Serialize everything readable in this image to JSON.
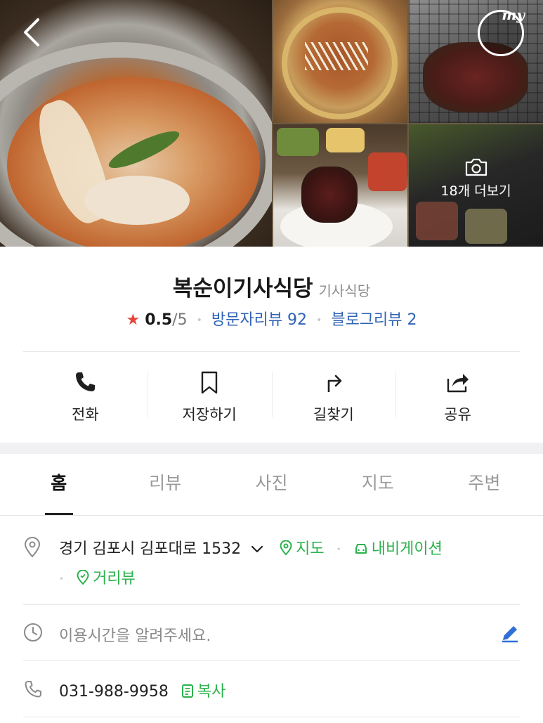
{
  "gallery": {
    "photos": [
      {
        "icon": "food-photo-stew"
      },
      {
        "icon": "food-photo-hotpot"
      },
      {
        "icon": "food-photo-grilled"
      },
      {
        "icon": "food-photo-sidedish"
      },
      {
        "icon": "food-photo-table"
      }
    ],
    "more_label": "18개 더보기",
    "badge_label": "my"
  },
  "place": {
    "name": "복순이기사식당",
    "category": "기사식당",
    "rating": "0.5",
    "rating_max": "/5",
    "visitor_review": "방문자리뷰 92",
    "blog_review": "블로그리뷰 2"
  },
  "actions": [
    {
      "label": "전화",
      "icon": "phone-icon"
    },
    {
      "label": "저장하기",
      "icon": "bookmark-icon"
    },
    {
      "label": "길찾기",
      "icon": "directions-icon"
    },
    {
      "label": "공유",
      "icon": "share-icon"
    }
  ],
  "tabs": [
    {
      "label": "홈",
      "active": true
    },
    {
      "label": "리뷰"
    },
    {
      "label": "사진"
    },
    {
      "label": "지도"
    },
    {
      "label": "주변"
    }
  ],
  "info": {
    "address": "경기 김포시 김포대로 1532",
    "map_link": "지도",
    "navigation_link": "내비게이션",
    "street_view_link": "거리뷰",
    "hours_placeholder": "이용시간을 알려주세요.",
    "phone": "031-988-9958",
    "copy_label": "복사"
  },
  "colors": {
    "rating_star": "#e2453c",
    "review_link": "#2f63b5",
    "map_link": "#2bb24c",
    "edit_icon": "#2f6fd8"
  }
}
